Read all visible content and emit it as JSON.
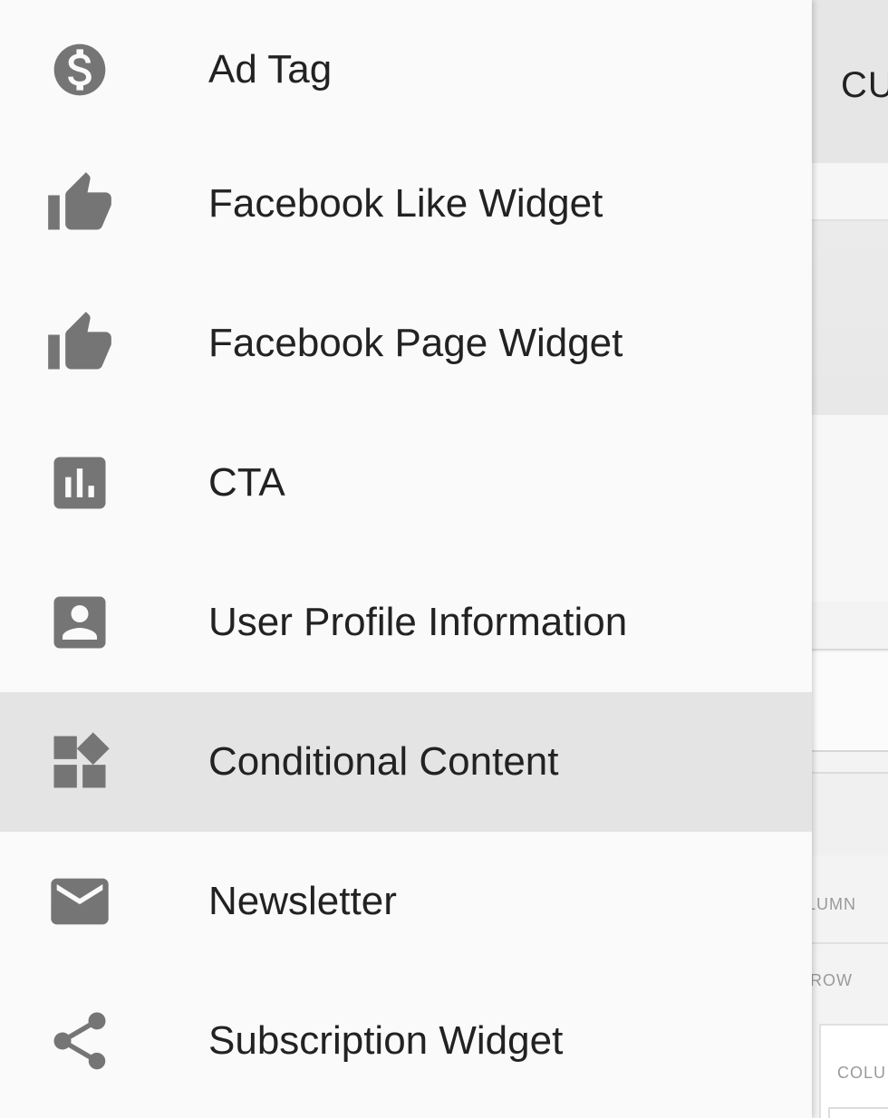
{
  "background_app": {
    "header_text": "CU",
    "label_column": "LUMN",
    "label_row": "ROW",
    "label_colu": "COLU"
  },
  "colors": {
    "icon": "#757575",
    "text": "#222222",
    "selected_bg": "#e4e4e4",
    "drawer_bg": "#fafafa"
  },
  "menu": {
    "items": [
      {
        "label": "Ad Tag",
        "icon": "dollar-circle-icon"
      },
      {
        "label": "Facebook Like Widget",
        "icon": "thumb-up-icon"
      },
      {
        "label": "Facebook Page Widget",
        "icon": "thumb-up-icon"
      },
      {
        "label": "CTA",
        "icon": "bar-chart-icon"
      },
      {
        "label": "User Profile Information",
        "icon": "account-box-icon"
      },
      {
        "label": "Conditional Content",
        "icon": "widgets-icon",
        "selected": true
      },
      {
        "label": "Newsletter",
        "icon": "mail-icon"
      },
      {
        "label": "Subscription Widget",
        "icon": "share-icon"
      }
    ]
  }
}
